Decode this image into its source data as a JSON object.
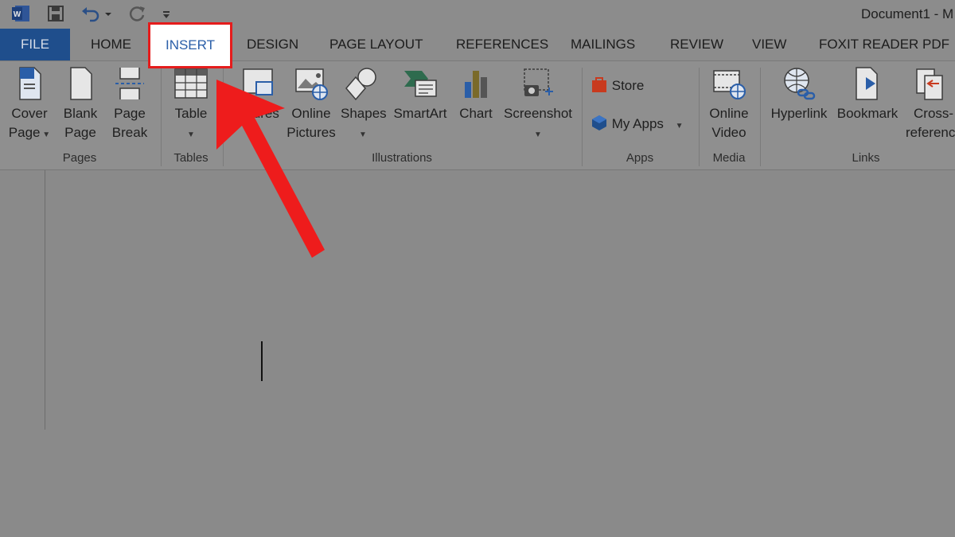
{
  "window": {
    "title": "Document1 - M"
  },
  "tabs": [
    {
      "label": "FILE"
    },
    {
      "label": "HOME"
    },
    {
      "label": "INSERT"
    },
    {
      "label": "DESIGN"
    },
    {
      "label": "PAGE LAYOUT"
    },
    {
      "label": "REFERENCES"
    },
    {
      "label": "MAILINGS"
    },
    {
      "label": "REVIEW"
    },
    {
      "label": "VIEW"
    },
    {
      "label": "FOXIT READER PDF"
    }
  ],
  "ribbon": {
    "pages": {
      "label": "Pages",
      "cover_page": [
        "Cover",
        "Page"
      ],
      "blank_page": [
        "Blank",
        "Page"
      ],
      "page_break": [
        "Page",
        "Break"
      ]
    },
    "tables": {
      "label": "Tables",
      "table": "Table"
    },
    "illustrations": {
      "label": "Illustrations",
      "pictures": "tures",
      "online_pictures": [
        "Online",
        "Pictures"
      ],
      "shapes": "Shapes",
      "smartart": "SmartArt",
      "chart": "Chart",
      "screenshot": "Screenshot"
    },
    "apps": {
      "label": "Apps",
      "store": "Store",
      "my_apps": "My Apps"
    },
    "media": {
      "label": "Media",
      "online_video": [
        "Online",
        "Video"
      ]
    },
    "links": {
      "label": "Links",
      "hyperlink": "Hyperlink",
      "bookmark": "Bookmark",
      "cross_reference": [
        "Cross-",
        "referenc"
      ]
    }
  },
  "colors": {
    "file_tab": "#1f4e8c",
    "highlight_box": "#e51c1c",
    "arrow": "#ee1c1c",
    "active_tab_text": "#2a5ea8"
  },
  "icons": [
    "word-icon",
    "save-icon",
    "undo-icon",
    "redo-icon",
    "customize-qat-icon"
  ]
}
